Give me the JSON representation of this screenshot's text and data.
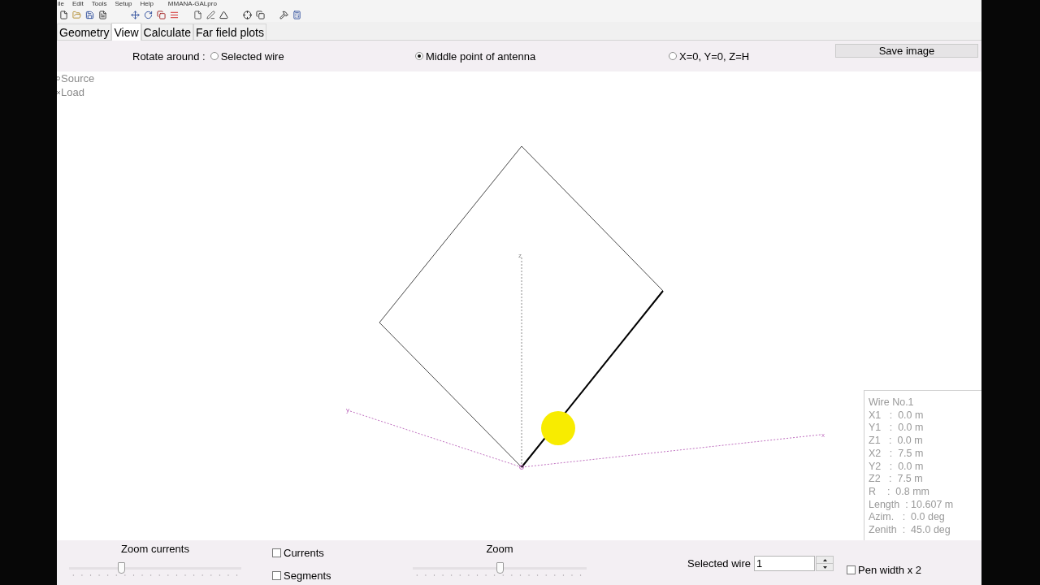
{
  "menu_bar": {
    "items": [
      "ile",
      "Edit",
      "Tools",
      "Setup",
      "Help"
    ],
    "title": "MMANA-GALpro"
  },
  "tabs": [
    {
      "label": "Geometry",
      "selected": false
    },
    {
      "label": "View",
      "selected": true
    },
    {
      "label": "Calculate",
      "selected": false
    },
    {
      "label": "Far field plots",
      "selected": false
    }
  ],
  "rotate_bar": {
    "label": "Rotate around :",
    "options": [
      {
        "label": "Selected wire",
        "selected": false
      },
      {
        "label": "Middle point of antenna",
        "selected": true
      },
      {
        "label": "X=0, Y=0, Z=H",
        "selected": false
      }
    ],
    "save_button": "Save image"
  },
  "legend": [
    {
      "kind": "source",
      "label": "Source"
    },
    {
      "kind": "load",
      "label": "Load"
    }
  ],
  "view": {
    "wires": [
      {
        "selected": true
      },
      {
        "selected": false
      },
      {
        "selected": false
      },
      {
        "selected": false
      }
    ],
    "axes": [
      {
        "kind": "z",
        "label": "z"
      },
      {
        "kind": "y",
        "label": "y"
      },
      {
        "kind": "x",
        "label": "x"
      }
    ]
  },
  "wire_info": {
    "title": "Wire No.1",
    "lines": [
      "X1   :  0.0 m",
      "Y1   :  0.0 m",
      "Z1   :  0.0 m",
      "X2   :  7.5 m",
      "Y2   :  0.0 m",
      "Z2   :  7.5 m",
      "R    :  0.8 mm",
      "Length  : 10.607 m",
      "Azim.   :  0.0 deg",
      "Zenith  :  45.0 deg"
    ]
  },
  "bottom_bar": {
    "zoom_currents": {
      "label": "Zoom currents",
      "level": 0.3
    },
    "checkboxes": [
      {
        "label": "Currents",
        "checked": false
      },
      {
        "label": "Segments",
        "checked": false
      }
    ],
    "zoom": {
      "label": "Zoom",
      "level": 0.5
    },
    "selected_wire": {
      "label": "Selected wire",
      "value": "1"
    },
    "pen_width": {
      "label": "Pen width x 2",
      "checked": false
    }
  }
}
